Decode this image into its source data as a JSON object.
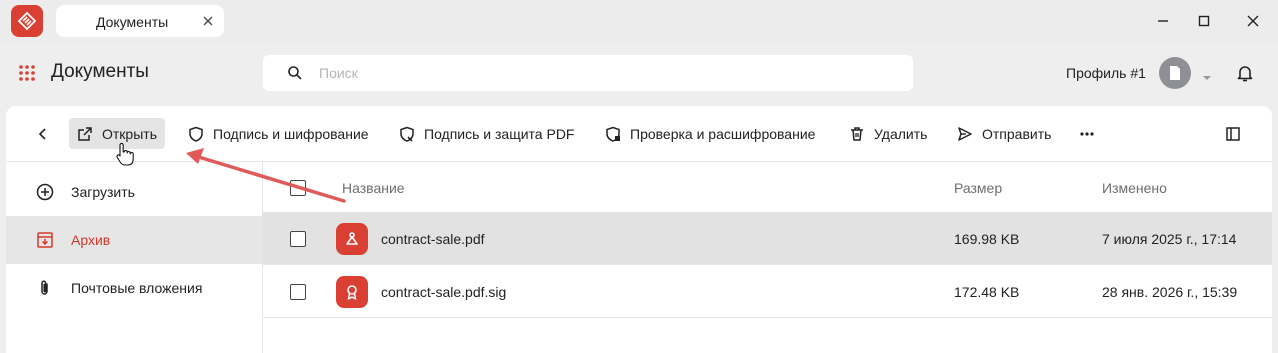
{
  "window": {
    "tab_title": "Документы"
  },
  "header": {
    "title": "Документы",
    "search_placeholder": "Поиск",
    "profile_name": "Профиль #1"
  },
  "toolbar": {
    "open_label": "Открыть",
    "sign_encrypt_label": "Подпись и шифрование",
    "sign_pdf_label": "Подпись и защита PDF",
    "verify_decrypt_label": "Проверка и расшифрование",
    "delete_label": "Удалить",
    "send_label": "Отправить"
  },
  "sidebar": {
    "items": [
      {
        "label": "Загрузить",
        "icon": "plus-circle-icon"
      },
      {
        "label": "Архив",
        "icon": "archive-icon",
        "active": true
      },
      {
        "label": "Почтовые вложения",
        "icon": "paperclip-icon"
      }
    ]
  },
  "table": {
    "columns": [
      "Название",
      "Размер",
      "Изменено"
    ],
    "rows": [
      {
        "name": "contract-sale.pdf",
        "size": "169.98 KB",
        "modified": "7 июля 2025 г., 17:14",
        "icon": "pdf-icon",
        "selected": true
      },
      {
        "name": "contract-sale.pdf.sig",
        "size": "172.48 KB",
        "modified": "28 янв. 2026 г., 15:39",
        "icon": "signature-icon",
        "selected": false
      }
    ]
  },
  "colors": {
    "accent": "#d93f33",
    "arrow": "#e05a5a",
    "selected_row": "#e2e2e2"
  }
}
